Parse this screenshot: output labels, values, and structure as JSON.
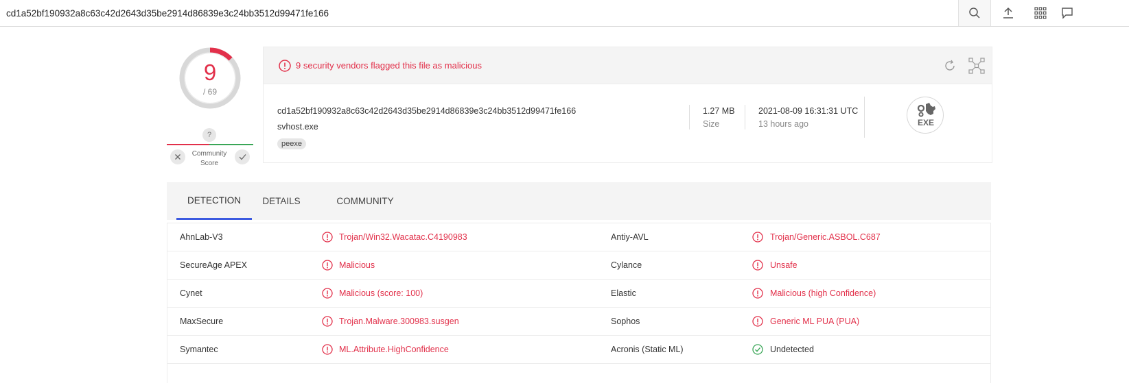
{
  "search": {
    "value": "cd1a52bf190932a8c63c42d2643d35be2914d86839e3c24bb3512d99471fe166"
  },
  "toolbar_icons": [
    "search-icon",
    "upload-icon",
    "apps-grid-icon",
    "chat-icon"
  ],
  "score": {
    "detections": "9",
    "total": "/ 69",
    "fraction": 0.1304,
    "question": "?",
    "community_label_line1": "Community",
    "community_label_line2": "Score"
  },
  "alert": {
    "text": "9 security vendors flagged this file as malicious"
  },
  "file": {
    "hash": "cd1a52bf190932a8c63c42d2643d35be2914d86839e3c24bb3512d99471fe166",
    "name": "svhost.exe",
    "tag": "peexe",
    "size_value": "1.27 MB",
    "size_label": "Size",
    "date_value": "2021-08-09 16:31:31 UTC",
    "date_relative": "13 hours ago",
    "type_label": "EXE"
  },
  "tabs": [
    {
      "label": "DETECTION",
      "active": true
    },
    {
      "label": "DETAILS",
      "active": false
    },
    {
      "label": "COMMUNITY",
      "active": false
    }
  ],
  "detections": [
    {
      "left_vendor": "AhnLab-V3",
      "left_result": "Trojan/Win32.Wacatac.C4190983",
      "left_status": "malicious",
      "right_vendor": "Antiy-AVL",
      "right_result": "Trojan/Generic.ASBOL.C687",
      "right_status": "malicious"
    },
    {
      "left_vendor": "SecureAge APEX",
      "left_result": "Malicious",
      "left_status": "malicious",
      "right_vendor": "Cylance",
      "right_result": "Unsafe",
      "right_status": "malicious"
    },
    {
      "left_vendor": "Cynet",
      "left_result": "Malicious (score: 100)",
      "left_status": "malicious",
      "right_vendor": "Elastic",
      "right_result": "Malicious (high Confidence)",
      "right_status": "malicious"
    },
    {
      "left_vendor": "MaxSecure",
      "left_result": "Trojan.Malware.300983.susgen",
      "left_status": "malicious",
      "right_vendor": "Sophos",
      "right_result": "Generic ML PUA (PUA)",
      "right_status": "malicious"
    },
    {
      "left_vendor": "Symantec",
      "left_result": "ML.Attribute.HighConfidence",
      "left_status": "malicious",
      "right_vendor": "Acronis (Static ML)",
      "right_result": "Undetected",
      "right_status": "undetected"
    }
  ],
  "colors": {
    "malicious": "#e2304a",
    "clean": "#3aa657",
    "tab_active": "#3c5ae0"
  }
}
